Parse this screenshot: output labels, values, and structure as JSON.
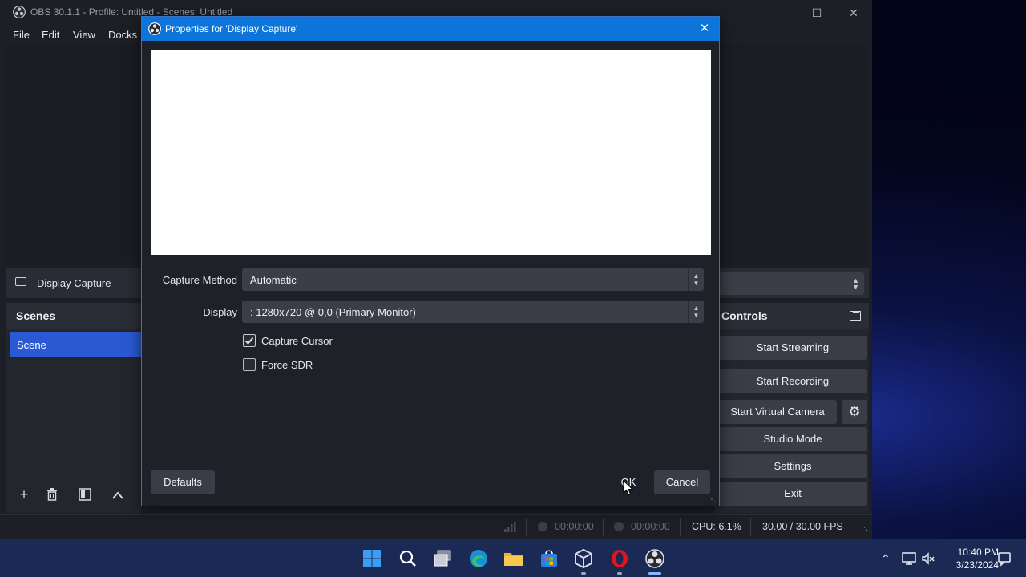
{
  "main_window": {
    "title": "OBS 30.1.1 - Profile: Untitled - Scenes: Untitled",
    "menu": [
      "File",
      "Edit",
      "View",
      "Docks"
    ],
    "source_bar": {
      "label": "Display Capture"
    },
    "scenes": {
      "title": "Scenes",
      "items": [
        "Scene"
      ]
    },
    "controls": {
      "title": "Controls",
      "start_streaming": "Start Streaming",
      "start_recording": "Start Recording",
      "start_virtual_camera": "Start Virtual Camera",
      "studio_mode": "Studio Mode",
      "settings": "Settings",
      "exit": "Exit"
    },
    "status": {
      "stream_time": "00:00:00",
      "record_time": "00:00:00",
      "cpu": "CPU: 6.1%",
      "fps": "30.00 / 30.00 FPS"
    }
  },
  "dialog": {
    "title": "Properties for 'Display Capture'",
    "capture_method": {
      "label": "Capture Method",
      "value": "Automatic"
    },
    "display": {
      "label": "Display",
      "value": ": 1280x720 @ 0,0 (Primary Monitor)"
    },
    "capture_cursor": {
      "label": "Capture Cursor",
      "checked": true
    },
    "force_sdr": {
      "label": "Force SDR",
      "checked": false
    },
    "buttons": {
      "defaults": "Defaults",
      "ok": "OK",
      "cancel": "Cancel"
    }
  },
  "taskbar": {
    "apps": [
      "windows-start",
      "search",
      "task-view",
      "edge",
      "file-explorer",
      "microsoft-store",
      "virtualbox",
      "opera",
      "obs-studio"
    ],
    "time": "10:40 PM",
    "date": "3/23/2024"
  },
  "colors": {
    "accent": "#0d74d9",
    "scene_selected": "#2b59d4",
    "button": "#3a3c47"
  }
}
